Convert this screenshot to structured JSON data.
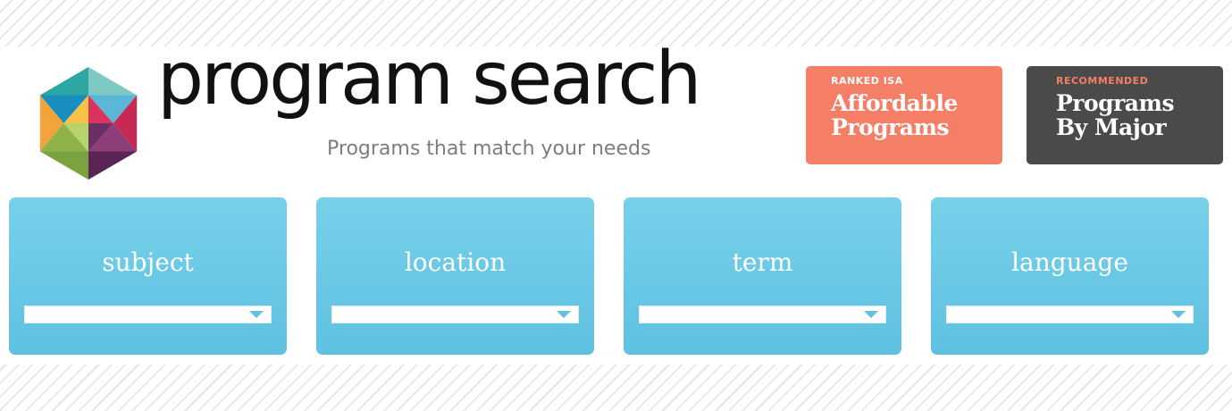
{
  "brand": {
    "title": "program search",
    "tagline": "Programs that match your needs",
    "logo_icon": "hexagon-cube-logo-icon"
  },
  "promos": [
    {
      "kicker": "RANKED ISA",
      "title": "Affordable\nPrograms",
      "color": "#f47f66"
    },
    {
      "kicker": "RECOMMENDED",
      "title": "Programs\nBy Major",
      "color": "#4a4a4a"
    }
  ],
  "filters": [
    {
      "label": "subject",
      "selected": ""
    },
    {
      "label": "location",
      "selected": ""
    },
    {
      "label": "term",
      "selected": ""
    },
    {
      "label": "language",
      "selected": ""
    }
  ],
  "colors": {
    "accent_blue": "#5ec1e0",
    "promo_coral": "#f47f66",
    "promo_dark": "#4a4a4a"
  }
}
